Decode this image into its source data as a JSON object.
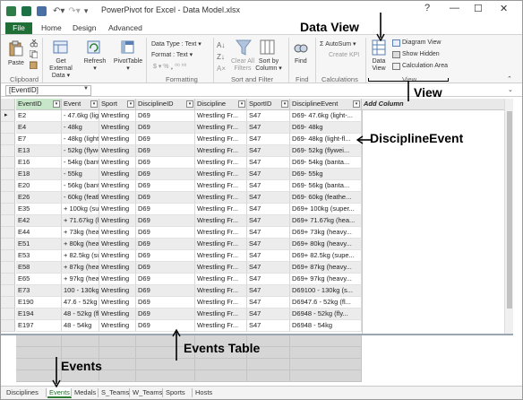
{
  "window": {
    "title": "PowerPivot for Excel - Data Model.xlsx",
    "controls": {
      "help": "?",
      "minimize": "—",
      "maximize": "☐",
      "close": "✕"
    }
  },
  "ribbon_tabs": {
    "file": "File",
    "home": "Home",
    "design": "Design",
    "advanced": "Advanced"
  },
  "ribbon": {
    "paste": "Paste",
    "get_external_data": [
      "Get External",
      "Data ▾"
    ],
    "refresh": [
      "Refresh",
      "▾"
    ],
    "pivottable": [
      "PivotTable",
      "▾"
    ],
    "data_type": "Data Type : Text ▾",
    "format": "Format : Text ▾",
    "format_symbols": "$ ▾  %  ❟  ⁰⁰ ⁰⁰",
    "clear_all_filters": [
      "Clear All",
      "Filters"
    ],
    "sort_by_column": [
      "Sort by",
      "Column ▾"
    ],
    "find": "Find",
    "autosum": "Σ AutoSum ▾",
    "create_kpi": "Create KPI",
    "data_view": [
      "Data",
      "View"
    ],
    "diagram_view": "Diagram View",
    "show_hidden": "Show Hidden",
    "calculation_area": "Calculation Area",
    "groups": {
      "clipboard": "Clipboard",
      "formatting": "Formatting",
      "sort_filter": "Sort and Filter",
      "find": "Find",
      "calculations": "Calculations",
      "view": "View"
    }
  },
  "formula_bar": {
    "name_box": "[EventID]"
  },
  "table": {
    "columns": [
      "EventID",
      "Event",
      "Sport",
      "DisciplineID",
      "Discipline",
      "SportID",
      "DisciplineEvent"
    ],
    "add_column": "Add Column",
    "rows": [
      [
        "E2",
        "- 47.6kg (light-...",
        "Wrestling",
        "D69",
        "Wrestling Fr...",
        "S47",
        "D69- 47.6kg (light-..."
      ],
      [
        "E4",
        "- 48kg",
        "Wrestling",
        "D69",
        "Wrestling Fr...",
        "S47",
        "D69- 48kg"
      ],
      [
        "E7",
        "- 48kg (light-fl...",
        "Wrestling",
        "D69",
        "Wrestling Fr...",
        "S47",
        "D69- 48kg (light-fl..."
      ],
      [
        "E13",
        "- 52kg (flywei...",
        "Wrestling",
        "D69",
        "Wrestling Fr...",
        "S47",
        "D69- 52kg (flywei..."
      ],
      [
        "E16",
        "- 54kg (banta...",
        "Wrestling",
        "D69",
        "Wrestling Fr...",
        "S47",
        "D69- 54kg (banta..."
      ],
      [
        "E18",
        "- 55kg",
        "Wrestling",
        "D69",
        "Wrestling Fr...",
        "S47",
        "D69- 55kg"
      ],
      [
        "E20",
        "- 56kg (banta...",
        "Wrestling",
        "D69",
        "Wrestling Fr...",
        "S47",
        "D69- 56kg (banta..."
      ],
      [
        "E26",
        "- 60kg (feathe...",
        "Wrestling",
        "D69",
        "Wrestling Fr...",
        "S47",
        "D69- 60kg (feathe..."
      ],
      [
        "E35",
        "+ 100kg (super...",
        "Wrestling",
        "D69",
        "Wrestling Fr...",
        "S47",
        "D69+ 100kg (super..."
      ],
      [
        "E42",
        "+ 71.67kg (hea...",
        "Wrestling",
        "D69",
        "Wrestling Fr...",
        "S47",
        "D69+ 71.67kg (hea..."
      ],
      [
        "E44",
        "+ 73kg (heavy...",
        "Wrestling",
        "D69",
        "Wrestling Fr...",
        "S47",
        "D69+ 73kg (heavy..."
      ],
      [
        "E51",
        "+ 80kg (heavy...",
        "Wrestling",
        "D69",
        "Wrestling Fr...",
        "S47",
        "D69+ 80kg (heavy..."
      ],
      [
        "E53",
        "+ 82.5kg (supe...",
        "Wrestling",
        "D69",
        "Wrestling Fr...",
        "S47",
        "D69+ 82.5kg (supe..."
      ],
      [
        "E58",
        "+ 87kg (heavy...",
        "Wrestling",
        "D69",
        "Wrestling Fr...",
        "S47",
        "D69+ 87kg (heavy..."
      ],
      [
        "E65",
        "+ 97kg (heavy...",
        "Wrestling",
        "D69",
        "Wrestling Fr...",
        "S47",
        "D69+ 97kg (heavy..."
      ],
      [
        "E73",
        "100 - 130kg (s...",
        "Wrestling",
        "D69",
        "Wrestling Fr...",
        "S47",
        "D69100 - 130kg (s..."
      ],
      [
        "E190",
        "47.6 - 52kg (fl...",
        "Wrestling",
        "D69",
        "Wrestling Fr...",
        "S47",
        "D6947.6 - 52kg (fl..."
      ],
      [
        "E194",
        "48 - 52kg (fly...",
        "Wrestling",
        "D69",
        "Wrestling Fr...",
        "S47",
        "D6948 - 52kg (fly..."
      ],
      [
        "E197",
        "48 - 54kg",
        "Wrestling",
        "D69",
        "Wrestling Fr...",
        "S47",
        "D6948 - 54kg"
      ]
    ]
  },
  "sheet_tabs": [
    "Disciplines",
    "Events",
    "Medals",
    "S_Teams",
    "W_Teams",
    "Sports",
    "Hosts"
  ],
  "active_sheet": "Events",
  "annotations": {
    "data_view": "Data View",
    "view": "View",
    "discipline_event": "DisciplineEvent",
    "events_table": "Events Table",
    "events": "Events"
  },
  "colors": {
    "file_tab": "#1f6f36",
    "selected_header": "#c8e6c9",
    "active_tab_accent": "#2e7d32",
    "calc_area": "#d6d6d6"
  }
}
